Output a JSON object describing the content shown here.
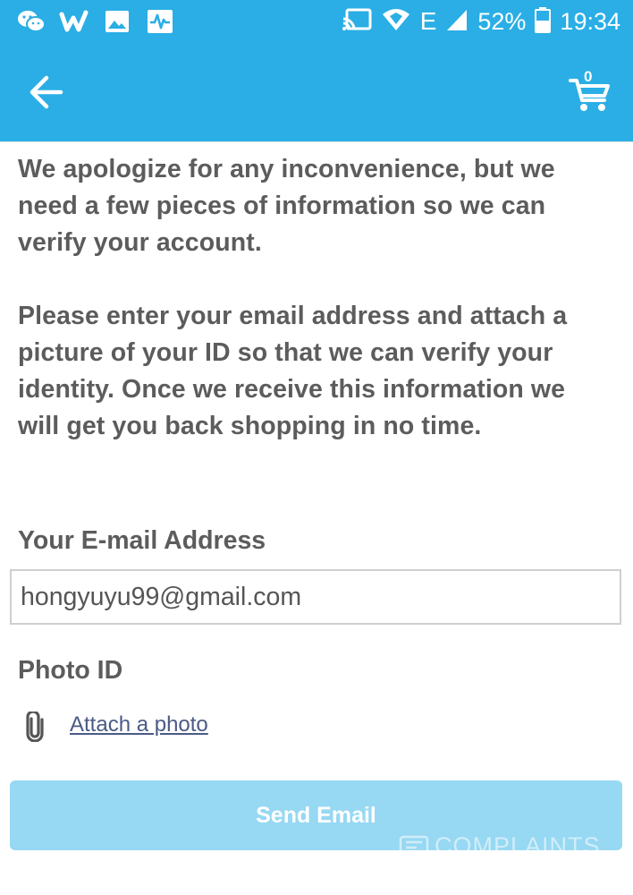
{
  "status_bar": {
    "battery_percent": "52%",
    "time": "19:34",
    "network_type": "E",
    "left_icons": [
      "wechat-icon",
      "wish-w-icon",
      "image-icon",
      "activity-icon"
    ],
    "right_icons": [
      "cast-icon",
      "wifi-icon",
      "signal-icon",
      "battery-icon"
    ]
  },
  "app_bar": {
    "back_icon": "arrow-left-icon",
    "cart_icon": "cart-icon",
    "cart_count": "0",
    "color": "#2aaee5"
  },
  "content": {
    "paragraph_1": "We apologize for any inconvenience, but we need a few pieces of information so we can verify your account.",
    "paragraph_2": "Please enter your email address and attach a picture of your ID so that we can verify your identity. Once we receive this information we will get you back shopping in no time."
  },
  "form": {
    "email_label": "Your E-mail Address",
    "email_value": "hongyuyu99@gmail.com",
    "photo_label": "Photo ID",
    "attach_label": "Attach a photo",
    "send_label": "Send Email",
    "send_color": "#97d8f3"
  },
  "watermark": {
    "text": "COMPLAINTS"
  }
}
